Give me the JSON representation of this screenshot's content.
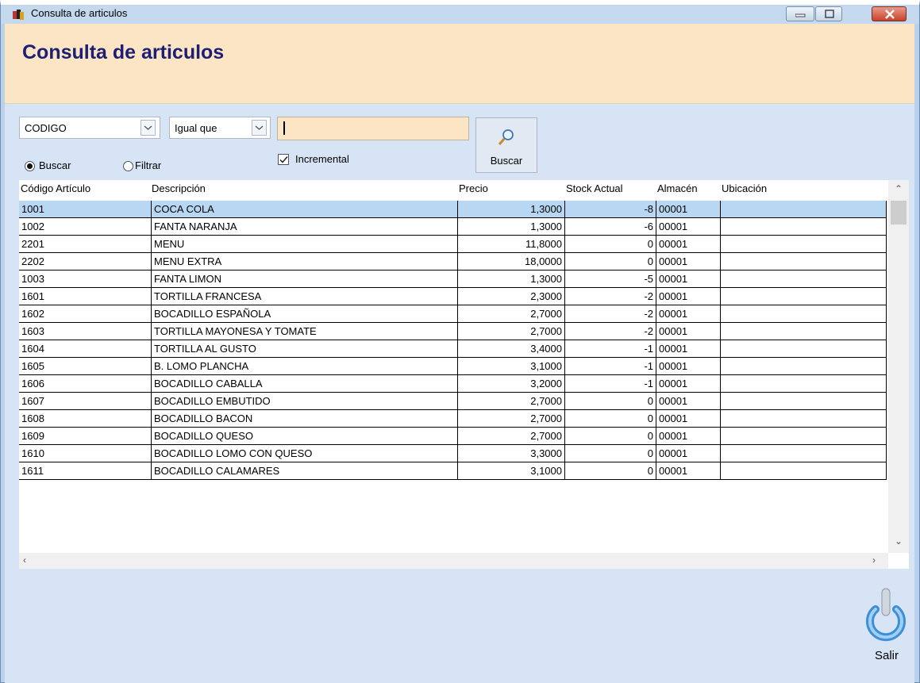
{
  "window": {
    "title": "Consulta de articulos"
  },
  "header": {
    "title": "Consulta de articulos"
  },
  "filters": {
    "field": "CODIGO",
    "operator": "Igual que",
    "search_value": "",
    "mode_buscar": "Buscar",
    "mode_filtrar": "Filtrar",
    "mode_selected": "Buscar",
    "incremental_label": "Incremental",
    "incremental_checked": true,
    "buscar_button": "Buscar"
  },
  "table": {
    "headers": [
      "Código Artículo",
      "Descripción",
      "Precio",
      "Stock Actual",
      "Almacén",
      "Ubicación"
    ],
    "rows": [
      [
        "1001",
        "COCA COLA",
        "1,3000",
        "-8",
        "00001",
        ""
      ],
      [
        "1002",
        "FANTA NARANJA",
        "1,3000",
        "-6",
        "00001",
        ""
      ],
      [
        "2201",
        "MENU",
        "11,8000",
        "0",
        "00001",
        ""
      ],
      [
        "2202",
        "MENU EXTRA",
        "18,0000",
        "0",
        "00001",
        ""
      ],
      [
        "1003",
        "FANTA LIMON",
        "1,3000",
        "-5",
        "00001",
        ""
      ],
      [
        "1601",
        "TORTILLA FRANCESA",
        "2,3000",
        "-2",
        "00001",
        ""
      ],
      [
        "1602",
        "BOCADILLO ESPAÑOLA",
        "2,7000",
        "-2",
        "00001",
        ""
      ],
      [
        "1603",
        " TORTILLA MAYONESA Y TOMATE",
        "2,7000",
        "-2",
        "00001",
        ""
      ],
      [
        "1604",
        "TORTILLA AL GUSTO",
        "3,4000",
        "-1",
        "00001",
        ""
      ],
      [
        "1605",
        "B. LOMO PLANCHA",
        "3,1000",
        "-1",
        "00001",
        ""
      ],
      [
        "1606",
        "BOCADILLO CABALLA",
        "3,2000",
        "-1",
        "00001",
        ""
      ],
      [
        "1607",
        "BOCADILLO EMBUTIDO",
        "2,7000",
        "0",
        "00001",
        ""
      ],
      [
        "1608",
        "BOCADILLO BACON",
        "2,7000",
        "0",
        "00001",
        ""
      ],
      [
        "1609",
        "BOCADILLO QUESO",
        "2,7000",
        "0",
        "00001",
        ""
      ],
      [
        "1610",
        "BOCADILLO LOMO CON QUESO",
        "3,3000",
        "0",
        "00001",
        ""
      ],
      [
        "1611",
        "BOCADILLO CALAMARES",
        "3,1000",
        "0",
        "00001",
        ""
      ]
    ],
    "selected_row": 0
  },
  "footer": {
    "exit_label": "Salir"
  },
  "colors": {
    "header_bg": "#fbe5c4",
    "title_color": "#1c1f73",
    "body_bg": "#d6e4f5",
    "selected_row": "#b8d7f2"
  }
}
